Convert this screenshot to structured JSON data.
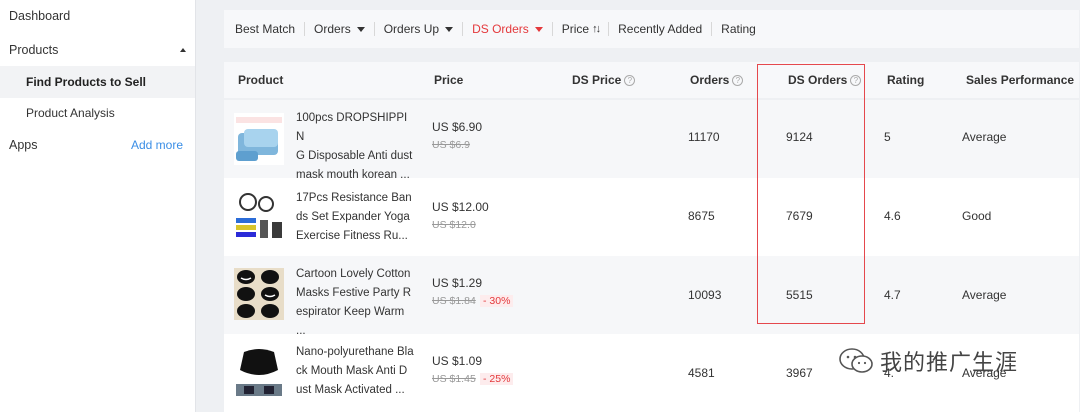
{
  "sidebar": {
    "dashboard": "Dashboard",
    "products": "Products",
    "find_products": "Find Products to Sell",
    "product_analysis": "Product Analysis",
    "apps": "Apps",
    "add_more": "Add more"
  },
  "sortbar": {
    "items": [
      "Best Match",
      "Orders",
      "Orders Up",
      "DS Orders",
      "Price",
      "Recently Added",
      "Rating"
    ]
  },
  "table": {
    "headers": [
      "Product",
      "Price",
      "DS Price",
      "Orders",
      "DS Orders",
      "Rating",
      "Sales Performance"
    ],
    "rows": [
      {
        "name_lines": [
          "100pcs DROPSHIPPIN",
          "G Disposable Anti dust",
          "mask mouth korean ..."
        ],
        "price": "US $6.90",
        "old_price": "US $6.9",
        "discount": "",
        "orders": "11170",
        "ds_orders": "9124",
        "rating": "5",
        "performance": "Average"
      },
      {
        "name_lines": [
          "17Pcs Resistance Ban",
          "ds Set Expander Yoga",
          "Exercise Fitness Ru..."
        ],
        "price": "US $12.00",
        "old_price": "US $12.0",
        "discount": "",
        "orders": "8675",
        "ds_orders": "7679",
        "rating": "4.6",
        "performance": "Good"
      },
      {
        "name_lines": [
          "Cartoon Lovely Cotton",
          "Masks Festive Party R",
          "espirator Keep Warm ..."
        ],
        "price": "US $1.29",
        "old_price": "US $1.84",
        "discount": "- 30%",
        "orders": "10093",
        "ds_orders": "5515",
        "rating": "4.7",
        "performance": "Average"
      },
      {
        "name_lines": [
          "Nano-polyurethane Bla",
          "ck Mouth Mask Anti D",
          "ust Mask Activated ..."
        ],
        "price": "US $1.09",
        "old_price": "US $1.45",
        "discount": "- 25%",
        "orders": "4581",
        "ds_orders": "3967",
        "rating": "4.",
        "performance": "Average"
      }
    ]
  },
  "watermark": "我的推广生涯",
  "colors": {
    "accent_red": "#e4393c",
    "highlight_border": "#e5484d",
    "link_blue": "#3a8ee6"
  }
}
